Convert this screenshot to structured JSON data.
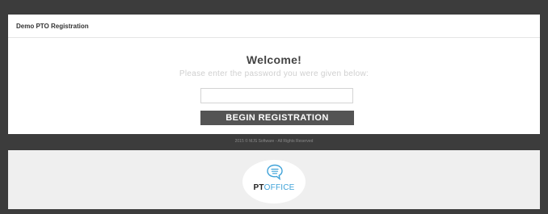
{
  "header": {
    "title": "Demo PTO Registration"
  },
  "main": {
    "welcome": "Welcome!",
    "instruction": "Please enter the password you were given below:",
    "password": {
      "value": "",
      "placeholder": ""
    },
    "begin_button_label": "BEGIN REGISTRATION"
  },
  "footer": {
    "copyright": "2015 © MJS Software - All Rights Reserved"
  },
  "logo": {
    "part1": "PT",
    "part2": "OFFICE",
    "icon": "chat-bubble-icon"
  },
  "colors": {
    "background": "#3c3c3c",
    "card": "#ffffff",
    "button": "#545454",
    "logo_accent": "#3fa2d8",
    "logo_panel": "#efefef"
  }
}
